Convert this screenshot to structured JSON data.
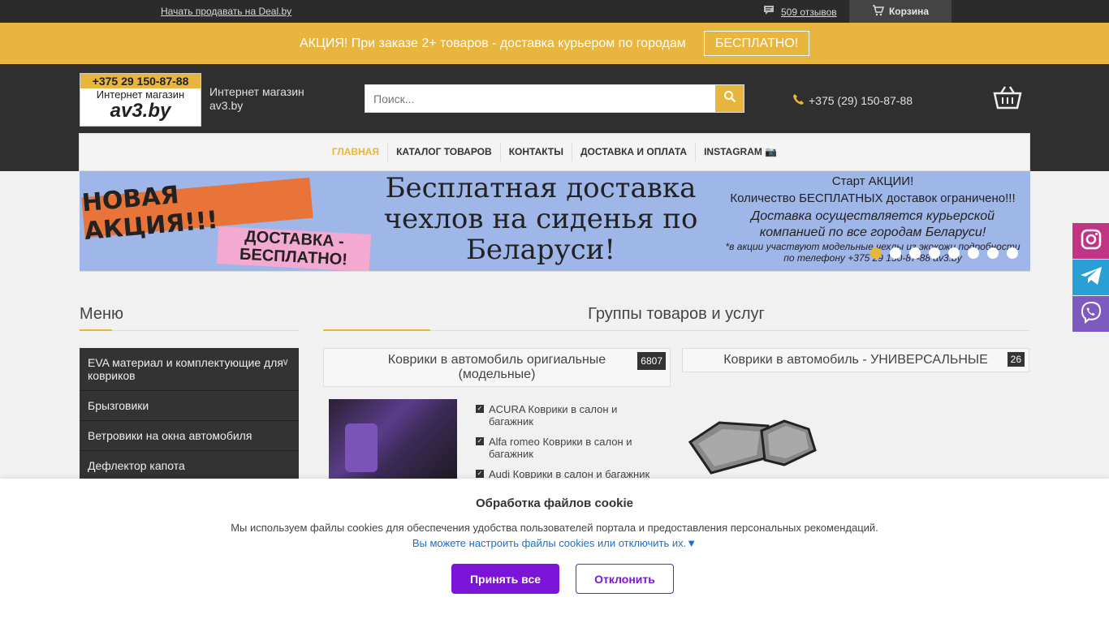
{
  "topbar": {
    "sell_link": "Начать продавать на Deal.by",
    "reviews": "509 отзывов",
    "cart": "Корзина"
  },
  "promo": {
    "text": "АКЦИЯ! При заказе 2+ товаров - доставка курьером по городам",
    "button": "БЕСПЛАТНО!"
  },
  "header": {
    "logo_phone": "+375 29 150-87-88",
    "logo_line1": "Интернет магазин",
    "logo_line2": "av3.by",
    "shop_name": "Интернет магазин av3.by",
    "search_placeholder": "Поиск...",
    "phone": "+375 (29) 150-87-88"
  },
  "nav": {
    "items": [
      "ГЛАВНАЯ",
      "КАТАЛОГ ТОВАРОВ",
      "КОНТАКТЫ",
      "ДОСТАВКА И ОПЛАТА",
      "INSTAGRAM 📷"
    ]
  },
  "banner": {
    "badge_new": "НОВАЯ АКЦИЯ!!!",
    "badge_free": "ДОСТАВКА - БЕСПЛАТНО!",
    "headline": "Бесплатная доставка чехлов на сиденья по Беларуси!",
    "start": "Старт АКЦИИ!",
    "limited": "Количество БЕСПЛАТНЫХ доставок ограничено!!!",
    "courier": "Доставка осуществляется курьерской компанией по все городам Беларуси!",
    "note": "*в акции участвуют модельные чехлы из экокожи подробности по телефону +375 29 150-87-88 av3.by",
    "slides_total": 8,
    "slide_active": 1
  },
  "menu": {
    "title": "Меню",
    "items": [
      "EVA материал и комплектующие для ковриков",
      "Брызговики",
      "Ветровики на окна автомобиля",
      "Дефлектор капота"
    ]
  },
  "groups": {
    "title": "Группы товаров и услуг",
    "card1": {
      "title": "Коврики в автомобиль оригиальные (модельные)",
      "count": "6807"
    },
    "card2": {
      "title": "Коврики в автомобиль - УНИВЕРСАЛЬНЫЕ",
      "count": "26"
    },
    "brands": [
      "ACURA Коврики в салон и багажник",
      "Alfa romeo Коврики в салон и багажник",
      "Audi Коврики в салон и багажник"
    ]
  },
  "cookie": {
    "title": "Обработка файлов cookie",
    "desc": "Мы используем файлы cookies для обеспечения удобства пользователей портала и предоставления персональных рекомендаций.",
    "link": "Вы можете настроить файлы cookies или отключить их.▼",
    "accept": "Принять все",
    "decline": "Отклонить"
  },
  "colors": {
    "accent": "#e8b53e",
    "dark": "#2f2f2f",
    "purple": "#7b14d6",
    "instagram": "#c13584",
    "telegram": "#2a9fd6",
    "viber": "#7d5ac0"
  },
  "icons": [
    "comment-icon",
    "cart-icon",
    "search-icon",
    "phone-icon",
    "basket-icon",
    "instagram-icon",
    "telegram-icon",
    "viber-icon",
    "checkbox-icon"
  ]
}
